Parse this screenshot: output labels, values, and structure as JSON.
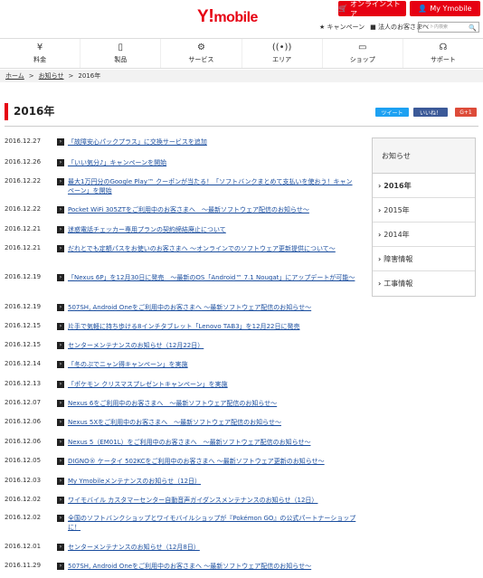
{
  "header": {
    "logo_y": "Y",
    "logo_bang": "!",
    "logo_mobile": "mobile",
    "store_label": "オンラインストア",
    "my_label": "My Ymobile",
    "campaign_label": "キャンペーン",
    "corporate_label": "法人のお客さまへ",
    "search_placeholder": "サイト内検索"
  },
  "nav": [
    {
      "icon": "yen",
      "label": "料金"
    },
    {
      "icon": "phone",
      "label": "製品"
    },
    {
      "icon": "gear",
      "label": "サービス"
    },
    {
      "icon": "antenna",
      "label": "エリア"
    },
    {
      "icon": "shop",
      "label": "ショップ"
    },
    {
      "icon": "support",
      "label": "サポート"
    }
  ],
  "breadcrumb": {
    "home": "ホーム",
    "notices": "お知らせ",
    "current": "2016年"
  },
  "page_title": "2016年",
  "social": {
    "tweet": "ツイート",
    "like": "いいね！",
    "gplus": "G+1"
  },
  "news": [
    {
      "date": "2016.12.27",
      "text": "「故障安心パックプラス」に交換サービスを追加"
    },
    {
      "date": "2016.12.26",
      "text": "「いい気分♪」キャンペーンを開始"
    },
    {
      "date": "2016.12.22",
      "text": "最大1万円分のGoogle Play™ クーポンが当たる！「ソフトバンクまとめて支払いを使おう！キャンペーン」を開始"
    },
    {
      "date": "2016.12.22",
      "text": "Pocket WiFi 305ZTをご利用中のお客さまへ　～最新ソフトウェア配信のお知らせ～"
    },
    {
      "date": "2016.12.21",
      "text": "迷惑電話チェッカー専用プランの契約締結廃止について"
    },
    {
      "date": "2016.12.21",
      "text": "だれとでも定額パスをお使いのお客さまへ ～オンラインでのソフトウェア更新提供について～"
    },
    {
      "date": "2016.12.19",
      "text": "「Nexus 6P」を12月30日に発売　～最新のOS「Android™ 7.1 Nougat」にアップデートが可能～"
    },
    {
      "date": "2016.12.19",
      "text": "507SH, Android Oneをご利用中のお客さまへ ～最新ソフトウェア配信のお知らせ～"
    },
    {
      "date": "2016.12.15",
      "text": "片手で気軽に持ち歩ける8インチタブレット「Lenovo TAB3」を12月22日に発売"
    },
    {
      "date": "2016.12.15",
      "text": "センターメンテナンスのお知らせ（12月22日）"
    },
    {
      "date": "2016.12.14",
      "text": "「冬のぷでニャン得キャンペーン」を実施"
    },
    {
      "date": "2016.12.13",
      "text": "「ポケモン クリスマスプレゼントキャンペーン」を実施"
    },
    {
      "date": "2016.12.07",
      "text": "Nexus 6をご利用中のお客さまへ　～最新ソフトウェア配信のお知らせ～"
    },
    {
      "date": "2016.12.06",
      "text": "Nexus 5Xをご利用中のお客さまへ　～最新ソフトウェア配信のお知らせ～"
    },
    {
      "date": "2016.12.06",
      "text": "Nexus 5（EM01L）をご利用中のお客さまへ　～最新ソフトウェア配信のお知らせ～"
    },
    {
      "date": "2016.12.05",
      "text": "DIGNO® ケータイ 502KCをご利用中のお客さまへ ～最新ソフトウェア更新のお知らせ～"
    },
    {
      "date": "2016.12.03",
      "text": "My Ymobileメンテナンスのお知らせ（12日）"
    },
    {
      "date": "2016.12.02",
      "text": "ワイモバイル カスタマーセンター自動音声ガイダンスメンテナンスのお知らせ（12日）"
    },
    {
      "date": "2016.12.02",
      "text": "全国のソフトバンクショップとワイモバイルショップが『Pokémon GO』の公式パートナーショップに！"
    },
    {
      "date": "2016.12.01",
      "text": "センターメンテナンスのお知らせ（12月8日）"
    },
    {
      "date": "2016.11.29",
      "text": "507SH, Android Oneをご利用中のお客さまへ ～最新ソフトウェア配信のお知らせ～"
    }
  ],
  "sidebar": {
    "heading": "お知らせ",
    "items": [
      "2016年",
      "2015年",
      "2014年",
      "障害情報",
      "工事情報"
    ]
  }
}
